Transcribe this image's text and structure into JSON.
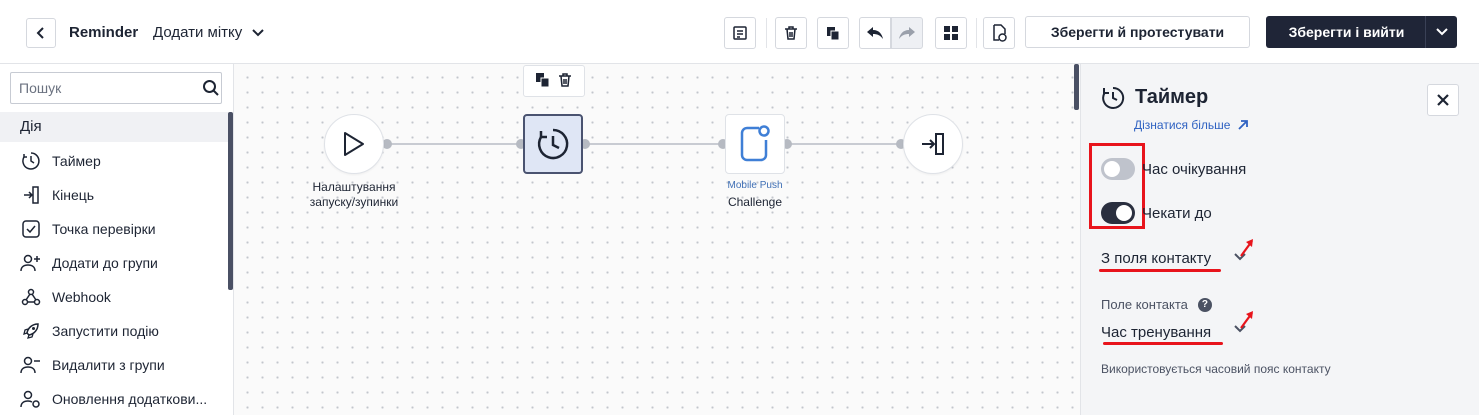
{
  "header": {
    "flow_name": "Reminder",
    "add_tag_label": "Додати мітку",
    "save_test_label": "Зберегти й протестувати",
    "save_exit_label": "Зберегти і вийти"
  },
  "sidebar": {
    "search_placeholder": "Пошук",
    "section_title": "Дія",
    "items": [
      {
        "label": "Таймер",
        "icon": "clock-icon"
      },
      {
        "label": "Кінець",
        "icon": "exit-icon"
      },
      {
        "label": "Точка перевірки",
        "icon": "checkpoint-icon"
      },
      {
        "label": "Додати до групи",
        "icon": "add-group-icon"
      },
      {
        "label": "Webhook",
        "icon": "webhook-icon"
      },
      {
        "label": "Запустити подію",
        "icon": "rocket-icon"
      },
      {
        "label": "Видалити з групи",
        "icon": "remove-group-icon"
      },
      {
        "label": "Оновлення додаткови...",
        "icon": "update-fields-icon"
      }
    ]
  },
  "canvas": {
    "start_node_label": "Налаштування запуску/зупинки",
    "push_node_type": "Mobile Push",
    "push_node_label": "Challenge"
  },
  "panel": {
    "title": "Таймер",
    "learn_more": "Дізнатися більше",
    "toggle_wait_time": {
      "label": "Час очікування",
      "on": false
    },
    "toggle_wait_until": {
      "label": "Чекати до",
      "on": true
    },
    "source_select": "З поля контакту",
    "contact_field_label": "Поле контакта",
    "contact_field_value": "Час тренування",
    "timezone_note": "Використовується часовий пояс контакту"
  },
  "colors": {
    "primary": "#1f2537",
    "accent_link": "#2f62c2",
    "annotation_red": "#e8141c",
    "selected_node_bg": "#dfe6f5"
  }
}
